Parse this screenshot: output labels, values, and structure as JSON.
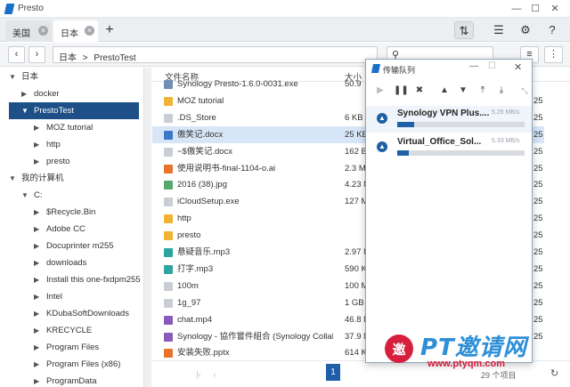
{
  "app": {
    "title": "Presto"
  },
  "tabs": [
    {
      "label": "美国"
    },
    {
      "label": "日本"
    }
  ],
  "path": {
    "root": "日本",
    "sep": ">",
    "folder": "PrestoTest"
  },
  "sidebar": {
    "items": [
      {
        "label": "日本",
        "indent": 0,
        "arrow": "▼"
      },
      {
        "label": "docker",
        "indent": 1,
        "arrow": "▶"
      },
      {
        "label": "PrestoTest",
        "indent": 1,
        "arrow": "▼",
        "selected": true
      },
      {
        "label": "MOZ tutorial",
        "indent": 2,
        "arrow": "▶"
      },
      {
        "label": "http",
        "indent": 2,
        "arrow": "▶"
      },
      {
        "label": "presto",
        "indent": 2,
        "arrow": "▶"
      },
      {
        "label": "我的计算机",
        "indent": 0,
        "arrow": "▼"
      },
      {
        "label": "C:",
        "indent": 1,
        "arrow": "▼"
      },
      {
        "label": "$Recycle.Bin",
        "indent": 2,
        "arrow": "▶"
      },
      {
        "label": "Adobe CC",
        "indent": 2,
        "arrow": "▶"
      },
      {
        "label": "Docuprinter m255",
        "indent": 2,
        "arrow": "▶"
      },
      {
        "label": "downloads",
        "indent": 2,
        "arrow": "▶"
      },
      {
        "label": "Install this one-fxdpm255",
        "indent": 2,
        "arrow": "▶"
      },
      {
        "label": "Intel",
        "indent": 2,
        "arrow": "▶"
      },
      {
        "label": "KDubaSoftDownloads",
        "indent": 2,
        "arrow": "▶"
      },
      {
        "label": "KRECYCLE",
        "indent": 2,
        "arrow": "▶"
      },
      {
        "label": "Program Files",
        "indent": 2,
        "arrow": "▶"
      },
      {
        "label": "Program Files (x86)",
        "indent": 2,
        "arrow": "▶"
      },
      {
        "label": "ProgramData",
        "indent": 2,
        "arrow": "▶"
      }
    ]
  },
  "columns": {
    "name": "文件名称",
    "size": "大小"
  },
  "files": [
    {
      "name": "Synology Presto-1.6.0-0031.exe",
      "size": "50.9",
      "modified": "",
      "icon": "exe",
      "color": "#6f8fb5"
    },
    {
      "name": "MOZ tutorial",
      "size": "",
      "modified": "25",
      "icon": "folder",
      "color": "#f2b233"
    },
    {
      "name": ".DS_Store",
      "size": "6 KB",
      "modified": "25",
      "icon": "file",
      "color": "#c9ced4"
    },
    {
      "name": "傲笑记.docx",
      "size": "25 KB",
      "modified": "25",
      "icon": "doc",
      "color": "#3c78c7",
      "selected": true
    },
    {
      "name": "~$傲笑记.docx",
      "size": "162 B",
      "modified": "25",
      "icon": "doc",
      "color": "#c9ced4"
    },
    {
      "name": "使用说明书-final-1104-o.ai",
      "size": "2.3 M",
      "modified": "25",
      "icon": "ai",
      "color": "#e8742a"
    },
    {
      "name": "2016 (38).jpg",
      "size": "4.23 M",
      "modified": "25",
      "icon": "image",
      "color": "#56a86b"
    },
    {
      "name": "iCloudSetup.exe",
      "size": "127 M",
      "modified": "25",
      "icon": "exe",
      "color": "#c9ced4"
    },
    {
      "name": "http",
      "size": "",
      "modified": "25",
      "icon": "folder",
      "color": "#f2b233"
    },
    {
      "name": "presto",
      "size": "",
      "modified": "25",
      "icon": "folder",
      "color": "#f2b233"
    },
    {
      "name": "悬疑音乐.mp3",
      "size": "2.97 M",
      "modified": "25",
      "icon": "audio",
      "color": "#2ca5a0"
    },
    {
      "name": "打字.mp3",
      "size": "590 K",
      "modified": "25",
      "icon": "audio",
      "color": "#2ca5a0"
    },
    {
      "name": "100m",
      "size": "100 M",
      "modified": "25",
      "icon": "file",
      "color": "#c9ced4"
    },
    {
      "name": "1g_97",
      "size": "1 GB",
      "modified": "25",
      "icon": "file",
      "color": "#c9ced4"
    },
    {
      "name": "chat.mp4",
      "size": "46.8 M",
      "modified": "25",
      "icon": "video",
      "color": "#8a5ab8"
    },
    {
      "name": "Synology - 協作嘗件組合 (Synology Collabo...",
      "size": "37.9 M",
      "modified": "25",
      "icon": "video",
      "color": "#8a5ab8"
    },
    {
      "name": "安装失败.pptx",
      "size": "614 K",
      "modified": "",
      "icon": "ppt",
      "color": "#e8742a"
    }
  ],
  "pager": {
    "page": "1",
    "summary": "29 个项目"
  },
  "queue": {
    "title": "传输队列",
    "items": [
      {
        "name": "Synology VPN Plus....",
        "speed": "5.26 MB/s",
        "progress": 0.13
      },
      {
        "name": "Virtual_Office_Sol...",
        "speed": "5.33 MB/s",
        "progress": 0.09
      }
    ]
  },
  "watermark": {
    "brand": "PT邀请网",
    "url": "www.ptyqm.com"
  },
  "colors": {
    "accent": "#1e5fa8",
    "selection": "#1e4f86"
  }
}
